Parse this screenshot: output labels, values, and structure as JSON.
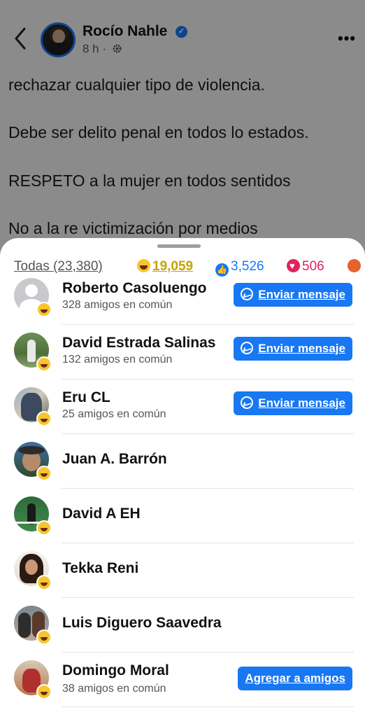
{
  "post": {
    "author": "Rocío Nahle",
    "time": "8 h ·",
    "text_lines": [
      "rechazar cualquier tipo de violencia.",
      "Debe ser delito penal en todos lo estados.",
      " RESPETO a la mujer en todos sentidos",
      "No a la re victimización por medios"
    ]
  },
  "icons": {
    "back": "chevron-left-icon",
    "verified": "verified-badge-icon",
    "privacy": "gear-icon",
    "more": "more-options-icon",
    "messenger": "messenger-icon",
    "haha": "haha-reaction-icon",
    "like": "like-reaction-icon",
    "love": "love-reaction-icon",
    "angry": "angry-reaction-icon"
  },
  "colors": {
    "accent": "#1877f2",
    "haha": "#f7c52e",
    "love": "#e0245e"
  },
  "reactions": {
    "all_label": "Todas (23,380)",
    "haha_count": "19,059",
    "like_count": "3,526",
    "love_count": "506"
  },
  "people": [
    {
      "name": "Roberto Casoluengo",
      "mutual": "328 amigos en común",
      "action": "Enviar mensaje"
    },
    {
      "name": "David Estrada Salinas",
      "mutual": "132 amigos en común",
      "action": "Enviar mensaje"
    },
    {
      "name": "Eru CL",
      "mutual": "25 amigos en común",
      "action": "Enviar mensaje"
    },
    {
      "name": "Juan A. Barrón"
    },
    {
      "name": "David A EH"
    },
    {
      "name": "Tekka Reni"
    },
    {
      "name": "Luis Diguero Saavedra"
    },
    {
      "name": "Domingo Moral",
      "mutual": "38 amigos en común",
      "action": "Agregar a amigos"
    }
  ]
}
